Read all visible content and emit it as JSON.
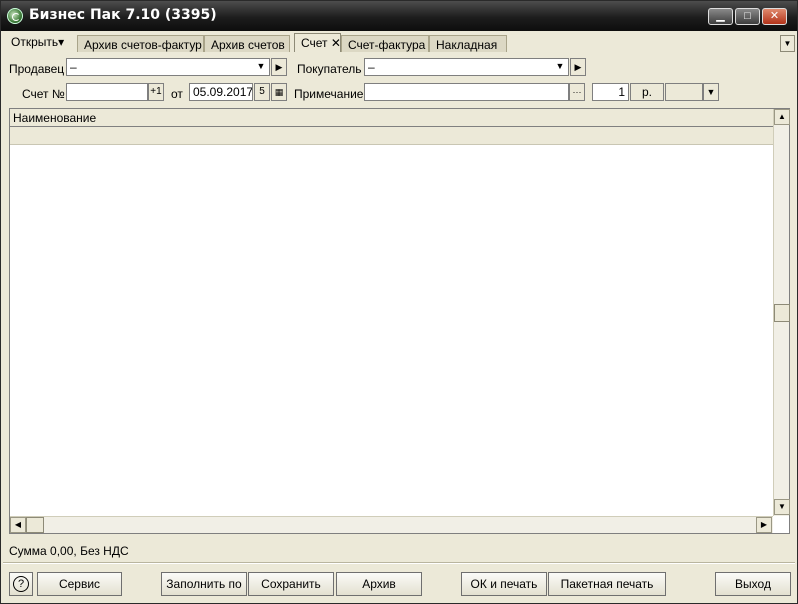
{
  "window": {
    "title": "Бизнес Пак 7.10 (3395)"
  },
  "window_controls": {
    "minimize": "▁",
    "maximize": "□",
    "close": "✕"
  },
  "toolbar": {
    "open_menu": "Открыть▾"
  },
  "tabs": [
    {
      "label": "Архив счетов-фактур"
    },
    {
      "label": "Архив счетов"
    },
    {
      "label": "Счет ✕"
    },
    {
      "label": "Счет-фактура"
    },
    {
      "label": "Накладная"
    }
  ],
  "form": {
    "seller_label": "Продавец",
    "seller_value": "–",
    "buyer_label": "Покупатель",
    "buyer_value": "–",
    "invoice_no_label": "Счет №",
    "invoice_no_value": "",
    "increment_label": "+1",
    "from_label": "от",
    "date_value": "05.09.2017",
    "day_button": "5",
    "note_label": "Примечание",
    "note_value": "",
    "ellipsis": "···",
    "rate_value": "1",
    "currency_label": "р."
  },
  "grid": {
    "column_header": "Наименование"
  },
  "status": {
    "summary": "Сумма 0,00, Без НДС"
  },
  "buttons": {
    "help": "?",
    "service": "Сервис",
    "fill_by": "Заполнить по",
    "save": "Сохранить",
    "archive": "Архив",
    "ok_print": "ОК и печать",
    "batch_print": "Пакетная печать",
    "exit": "Выход"
  }
}
